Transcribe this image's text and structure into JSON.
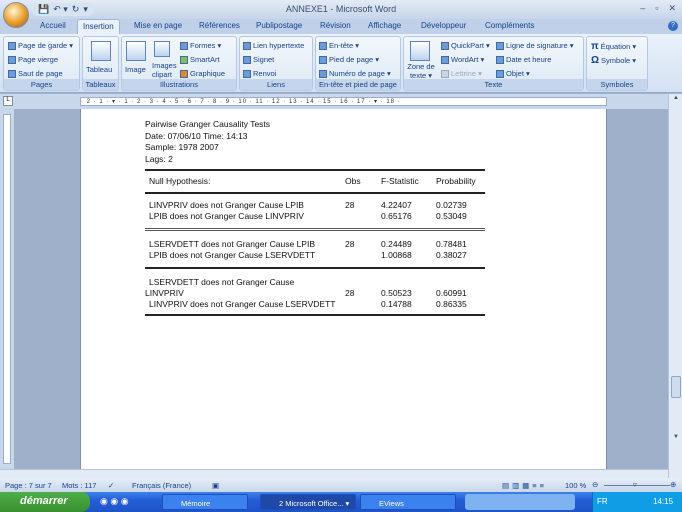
{
  "window": {
    "title": "ANNEXE1 - Microsoft Word",
    "controls": [
      "–",
      "▫",
      "✕"
    ]
  },
  "qat": [
    "💾",
    "↶ ▾",
    "↻",
    "▾"
  ],
  "tabs": [
    "Accueil",
    "Insertion",
    "Mise en page",
    "Références",
    "Publipostage",
    "Révision",
    "Affichage",
    "Développeur",
    "Compléments"
  ],
  "ribbon": {
    "pages": {
      "label": "Pages",
      "items": [
        "Page de garde ▾",
        "Page vierge",
        "Saut de page"
      ]
    },
    "tableaux": {
      "label": "Tableaux",
      "items": [
        "Tableau"
      ]
    },
    "illustrations": {
      "label": "Illustrations",
      "items": [
        "Image",
        "Images clipart",
        "Formes ▾",
        "SmartArt",
        "Graphique"
      ]
    },
    "liens": {
      "label": "Liens",
      "items": [
        "Lien hypertexte",
        "Signet",
        "Renvoi"
      ]
    },
    "entete": {
      "label": "En-tête et pied de page",
      "items": [
        "En-tête ▾",
        "Pied de page ▾",
        "Numéro de page ▾"
      ]
    },
    "texte": {
      "label": "Texte",
      "items": [
        "Zone de texte ▾",
        "QuickPart ▾",
        "WordArt ▾",
        "Lettrine ▾",
        "Ligne de signature ▾",
        "Date et heure",
        "Objet ▾"
      ]
    },
    "symboles": {
      "label": "Symboles",
      "items": [
        "Équation ▾",
        "Symbole ▾"
      ]
    }
  },
  "ruler": "· 2 · 1 · ▾ · 1 · 2 · 3 · 4 · 5 · 6 · 7 · 8 · 9 · 10 · 11 · 12 · 13 · 14 · 15 · 16 · 17 · ▾ · 18 ·",
  "document": {
    "header": [
      "Pairwise Granger Causality Tests",
      "Date: 07/06/10   Time:  14:13",
      "Sample: 1978 2007",
      "Lags: 2"
    ],
    "columns": [
      "Null Hypothesis:",
      "Obs",
      "F-Statistic",
      "Probability"
    ],
    "groups": [
      [
        [
          "LINVPRIV  does not Granger Cause  LPIB",
          "28",
          "4.22407",
          "0.02739"
        ],
        [
          "LPIB does not Granger Cause  LINVPRIV",
          "",
          "0.65176",
          "0.53049"
        ]
      ],
      [
        [
          "LSERVDETT  does not Granger Cause  LPIB",
          "28",
          "0.24489",
          "0.78481"
        ],
        [
          "LPIB does not Granger Cause  LSERVDETT",
          "",
          "1.00868",
          "0.38027"
        ]
      ],
      [
        [
          "LSERVDETT  does not Granger Cause",
          "",
          "",
          ""
        ],
        [
          "LINVPRIV",
          "28",
          "0.50523",
          "0.60991"
        ],
        [
          "LINVPRIV  does not Granger Cause  LSERVDETT",
          "",
          "0.14788",
          "0.86335"
        ]
      ]
    ]
  },
  "status": {
    "page": "Page : 7 sur 7",
    "words": "Mots : 117",
    "language": "Français (France)",
    "zoom": "100 %"
  },
  "taskbar": {
    "start": "démarrer",
    "items": [
      "Mémoire",
      "2 Microsoft Office... ▾",
      "EViews"
    ],
    "lang": "FR",
    "time": "14:15"
  }
}
